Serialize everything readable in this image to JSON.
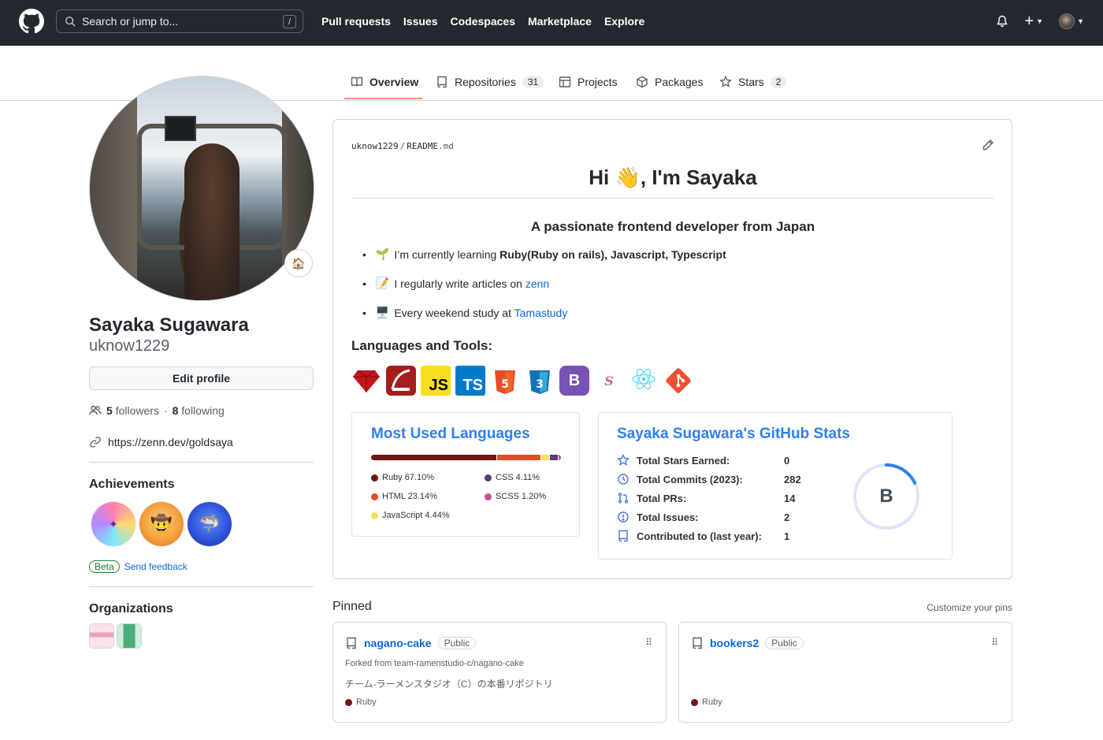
{
  "header": {
    "search_placeholder": "Search or jump to...",
    "search_shortcut": "/",
    "nav": [
      "Pull requests",
      "Issues",
      "Codespaces",
      "Marketplace",
      "Explore"
    ],
    "plus": "+"
  },
  "tabs": [
    {
      "label": "Overview"
    },
    {
      "label": "Repositories",
      "count": "31"
    },
    {
      "label": "Projects"
    },
    {
      "label": "Packages"
    },
    {
      "label": "Stars",
      "count": "2"
    }
  ],
  "profile": {
    "name": "Sayaka Sugawara",
    "login": "uknow1229",
    "edit_label": "Edit profile",
    "followers_count": "5",
    "followers_label": "followers",
    "separator": "·",
    "following_count": "8",
    "following_label": "following",
    "website": "https://zenn.dev/goldsaya",
    "status_emoji": "🏠"
  },
  "achievements": {
    "title": "Achievements",
    "beta": "Beta",
    "feedback": "Send feedback"
  },
  "organizations": {
    "title": "Organizations"
  },
  "readme": {
    "owner": "uknow1229",
    "slash": "/",
    "file": "README",
    "ext": ".md",
    "heading": "Hi 👋, I'm Sayaka",
    "subheading": "A passionate frontend developer from Japan",
    "bullets": [
      {
        "emoji": "🌱",
        "text": "I’m currently learning ",
        "strong": "Ruby(Ruby on rails), Javascript, Typescript",
        "link": ""
      },
      {
        "emoji": "📝",
        "text": "I regularly write articles on ",
        "strong": "",
        "link": "zenn"
      },
      {
        "emoji": "🖥️",
        "text": "Every weekend study at ",
        "strong": "",
        "link": "Tamastudy"
      }
    ],
    "tools_title": "Languages and Tools:",
    "tools": [
      "ruby-icon",
      "rails-icon",
      "javascript-icon",
      "typescript-icon",
      "html5-icon",
      "css3-icon",
      "bootstrap-icon",
      "sass-icon",
      "react-icon",
      "git-icon"
    ]
  },
  "languages_card": {
    "title": "Most Used Languages",
    "items": [
      {
        "name": "Ruby",
        "percent": "67.10%",
        "value": 67.1,
        "color": "#701516"
      },
      {
        "name": "HTML",
        "percent": "23.14%",
        "value": 23.14,
        "color": "#e34c26"
      },
      {
        "name": "JavaScript",
        "percent": "4.44%",
        "value": 4.44,
        "color": "#f1e05a"
      },
      {
        "name": "CSS",
        "percent": "4.11%",
        "value": 4.11,
        "color": "#563d7c"
      },
      {
        "name": "SCSS",
        "percent": "1.20%",
        "value": 1.2,
        "color": "#c6538c"
      }
    ]
  },
  "stats_card": {
    "title": "Sayaka Sugawara's GitHub Stats",
    "rows": [
      {
        "label": "Total Stars Earned:",
        "value": "0"
      },
      {
        "label": "Total Commits (2023):",
        "value": "282"
      },
      {
        "label": "Total PRs:",
        "value": "14"
      },
      {
        "label": "Total Issues:",
        "value": "2"
      },
      {
        "label": "Contributed to (last year):",
        "value": "1"
      }
    ],
    "rank": "B",
    "rank_progress": 0.18
  },
  "pinned": {
    "title": "Pinned",
    "customize": "Customize your pins",
    "items": [
      {
        "name": "nagano-cake",
        "visibility": "Public",
        "fork": "Forked from team-ramenstudio-c/nagano-cake",
        "description": "チーム-ラーメンスタジオ（C）の本番リポジトリ",
        "language": "Ruby",
        "lang_color": "#701516"
      },
      {
        "name": "bookers2",
        "visibility": "Public",
        "fork": "",
        "description": "",
        "language": "Ruby",
        "lang_color": "#701516"
      }
    ]
  },
  "colors": {
    "header_bg": "#24292f",
    "accent_tab": "#fd8c73",
    "link": "#0969da",
    "card_title": "#2f80ed"
  }
}
